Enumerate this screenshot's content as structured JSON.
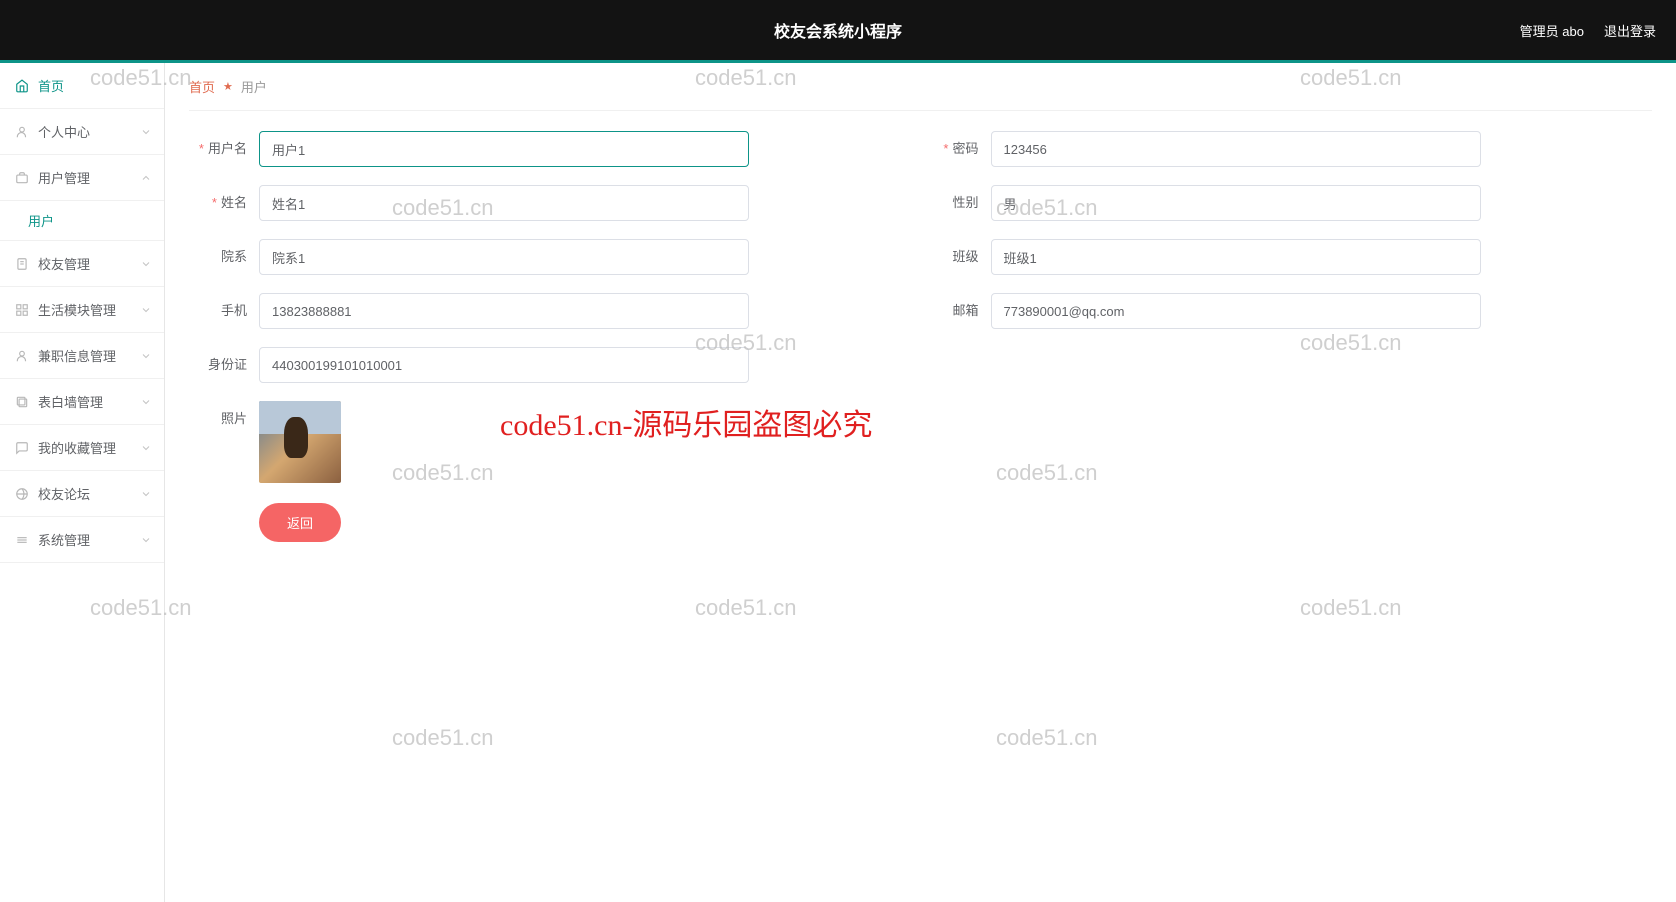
{
  "header": {
    "title": "校友会系统小程序",
    "admin": "管理员 abo",
    "logout": "退出登录"
  },
  "sidebar": {
    "home": "首页",
    "personal": "个人中心",
    "userMgmt": "用户管理",
    "user": "用户",
    "alumniMgmt": "校友管理",
    "lifeModule": "生活模块管理",
    "partTimeInfo": "兼职信息管理",
    "confessionWall": "表白墙管理",
    "myFavorites": "我的收藏管理",
    "alumniForum": "校友论坛",
    "systemMgmt": "系统管理"
  },
  "breadcrumb": {
    "home": "首页",
    "current": "用户"
  },
  "form": {
    "usernameLabel": "用户名",
    "username": "用户1",
    "passwordLabel": "密码",
    "password": "123456",
    "nameLabel": "姓名",
    "name": "姓名1",
    "genderLabel": "性别",
    "gender": "男",
    "deptLabel": "院系",
    "dept": "院系1",
    "classLabel": "班级",
    "classVal": "班级1",
    "phoneLabel": "手机",
    "phone": "13823888881",
    "emailLabel": "邮箱",
    "email": "773890001@qq.com",
    "idcardLabel": "身份证",
    "idcard": "440300199101010001",
    "photoLabel": "照片",
    "backBtn": "返回"
  },
  "watermarks": {
    "small": "code51.cn",
    "big": "code51.cn-源码乐园盗图必究"
  }
}
